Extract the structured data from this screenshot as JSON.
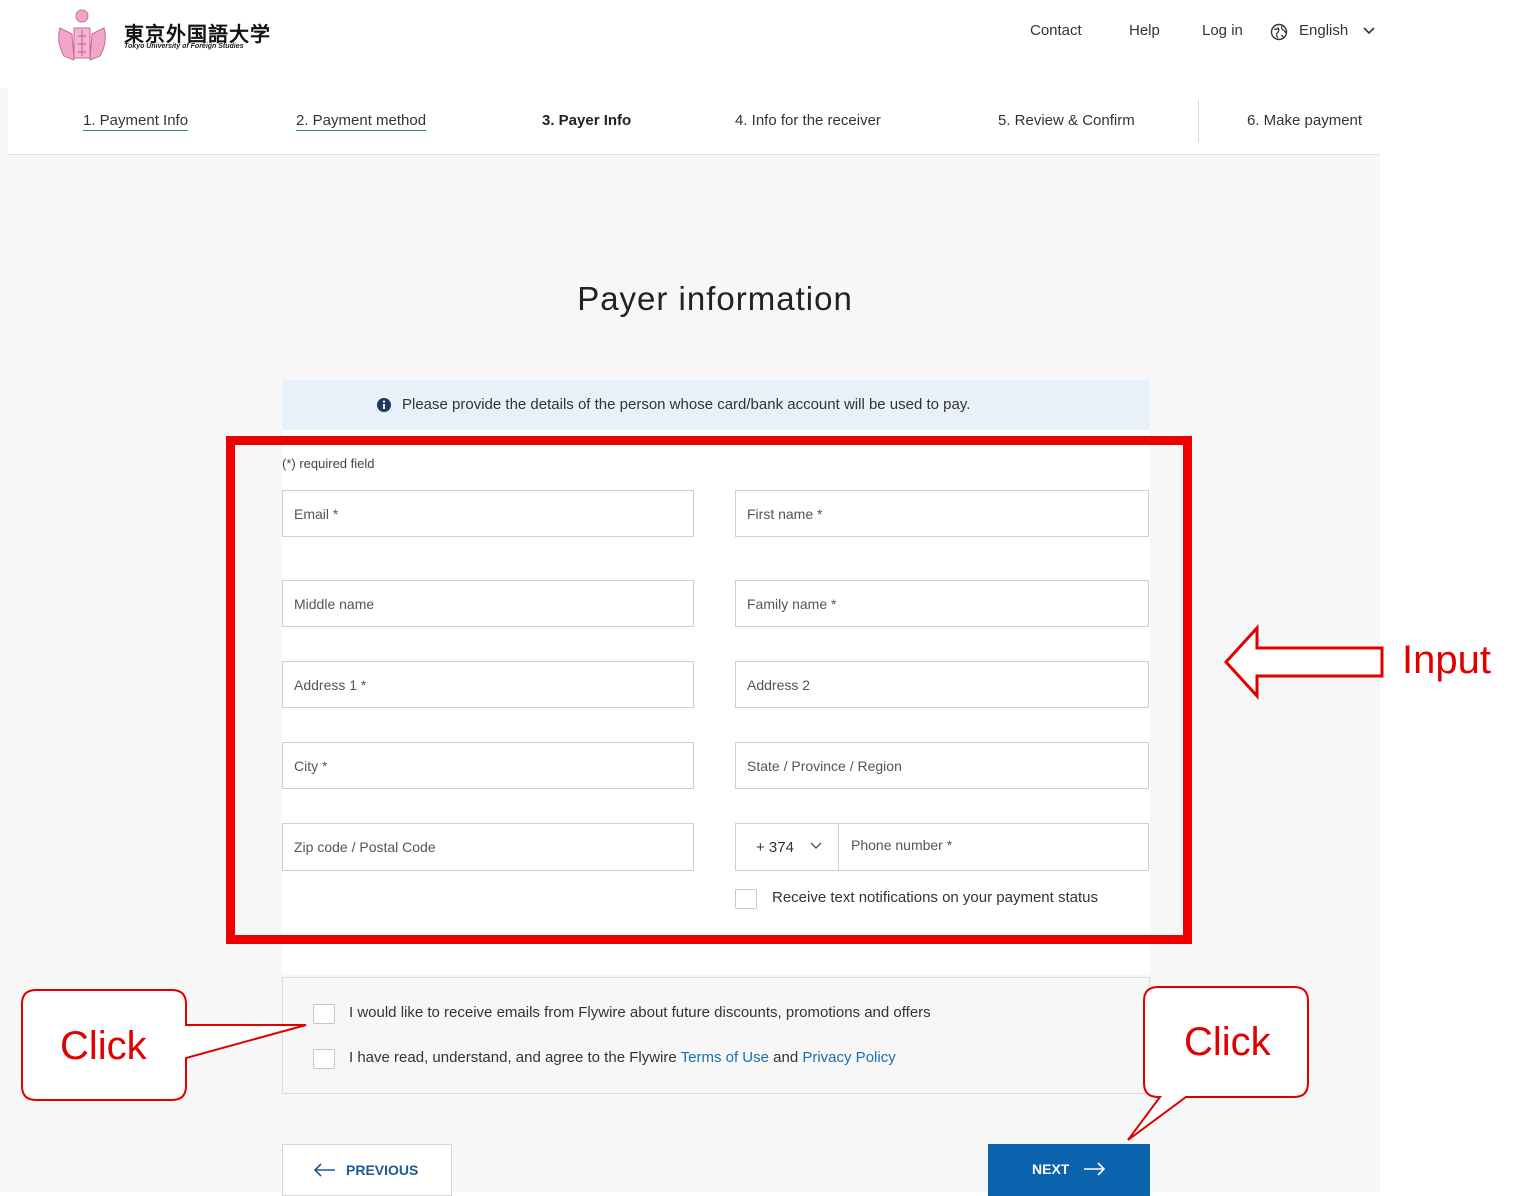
{
  "header": {
    "logo_jp": "東京外国語大学",
    "logo_en": "Tokyo University of Foreign Studies",
    "nav": [
      "Contact",
      "Help",
      "Log in"
    ],
    "language": "English",
    "language_icon": "globe-icon"
  },
  "steps": [
    {
      "label": "1. Payment Info",
      "state": "done"
    },
    {
      "label": "2. Payment method",
      "state": "done"
    },
    {
      "label": "3. Payer Info",
      "state": "active"
    },
    {
      "label": "4. Info for the receiver",
      "state": "pending"
    },
    {
      "label": "5. Review & Confirm",
      "state": "pending"
    },
    {
      "label": "6. Make payment",
      "state": "pending"
    }
  ],
  "page_title": "Payer information",
  "info_banner": "Please provide the details of the person whose card/bank account will be used to pay.",
  "required_note": "(*) required field",
  "fields": {
    "email": "Email *",
    "first_name": "First name *",
    "middle_name": "Middle name",
    "family_name": "Family name *",
    "address1": "Address 1 *",
    "address2": "Address 2",
    "city": "City *",
    "state": "State / Province / Region",
    "zip": "Zip code / Postal Code",
    "phone_code": "+ 374",
    "phone": "Phone number *"
  },
  "sms_checkbox": "Receive text notifications on your payment status",
  "agreements": {
    "promo": "I would like to receive emails from Flywire about future discounts, promotions and offers",
    "terms_prefix": "I have read, understand, and agree to the Flywire",
    "terms_link": "Terms of Use",
    "and": "and",
    "privacy_link": "Privacy Policy"
  },
  "buttons": {
    "previous": "PREVIOUS",
    "next": "NEXT"
  },
  "annotations": {
    "input_label": "Input",
    "click_label_left": "Click",
    "click_label_right": "Click",
    "color": "#e00000"
  }
}
